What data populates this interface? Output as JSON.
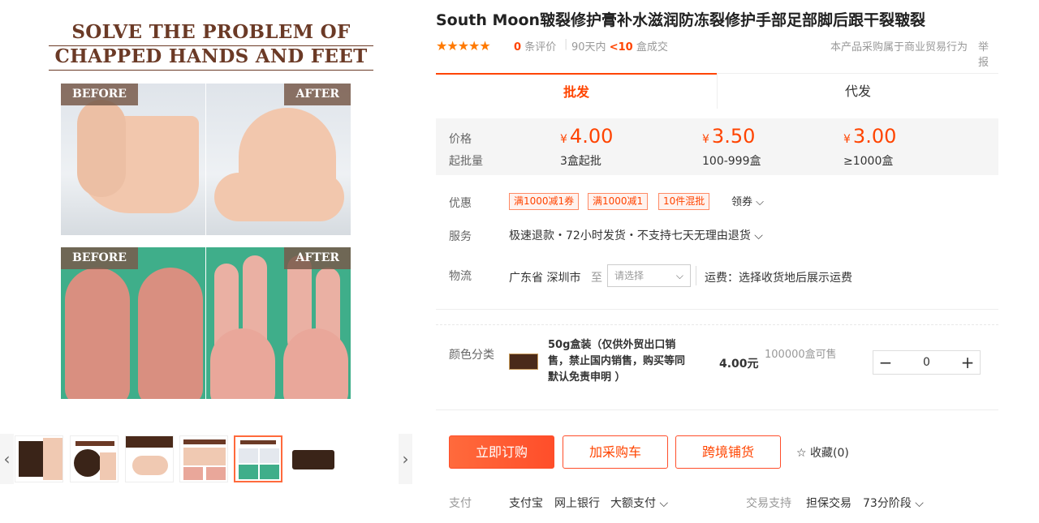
{
  "gallery": {
    "headline": [
      "SOLVE THE PROBLEM OF",
      "CHAPPED HANDS AND FEET"
    ],
    "tag_before": "BEFORE",
    "tag_after": "AFTER",
    "thumb_prev": "‹",
    "thumb_next": "›",
    "thumbs": [
      {
        "name": "thumb-1"
      },
      {
        "name": "thumb-2"
      },
      {
        "name": "thumb-3"
      },
      {
        "name": "thumb-4"
      },
      {
        "name": "thumb-5",
        "active": true
      },
      {
        "name": "thumb-6"
      }
    ]
  },
  "product": {
    "title": "South Moon皲裂修护膏补水滋润防冻裂修护手部足部脚后跟干裂皲裂",
    "stars": "★★★★★",
    "review_count": "0",
    "review_label": "条评价",
    "sales_prefix": "90天内",
    "sales_value": "<10",
    "sales_suffix": "盒成交",
    "trade_note": "本产品采购属于商业贸易行为",
    "report": "举报"
  },
  "tabs": {
    "wholesale": "批发",
    "dropship": "代发"
  },
  "price": {
    "label_price": "价格",
    "label_moq": "起批量",
    "currency": "¥",
    "tiers": [
      {
        "price": "4.00",
        "qty": "3盒起批"
      },
      {
        "price": "3.50",
        "qty": "100-999盒"
      },
      {
        "price": "3.00",
        "qty": "≥1000盒"
      }
    ]
  },
  "promo": {
    "label": "优惠",
    "coupons": [
      "满1000减1券",
      "满1000减1",
      "10件混批"
    ],
    "get_coupon": "领券 ⌵"
  },
  "service": {
    "label": "服务",
    "text": "极速退款・72小时发货・不支持七天无理由退货 ⌵"
  },
  "logistics": {
    "label": "物流",
    "origin": "广东省 深圳市",
    "to": "至",
    "select_placeholder": "请选择",
    "select_chevron": "⌵",
    "shipping": "运费：选择收货地后展示运费"
  },
  "sku": {
    "label": "颜色分类",
    "name": "50g盒装（仅供外贸出口销售，禁止国内销售，购买等同默认免责申明 ）",
    "price": "4.00元",
    "stock": "100000盒可售",
    "minus": "−",
    "qty": "0",
    "plus": "+"
  },
  "actions": {
    "buy_now": "立即订购",
    "add_cart": "加采购车",
    "cross_border": "跨境铺货",
    "favorite": "☆ 收藏(0)"
  },
  "payment": {
    "label": "支付",
    "methods": [
      "支付宝",
      "网上银行",
      "大额支付 ⌵"
    ],
    "trade_label": "交易支持",
    "trade_items": [
      "担保交易",
      "73分阶段 ⌵"
    ]
  },
  "colors": {
    "accent": "#ff4400",
    "headline": "#6b3a26",
    "star": "#ff7a00"
  }
}
